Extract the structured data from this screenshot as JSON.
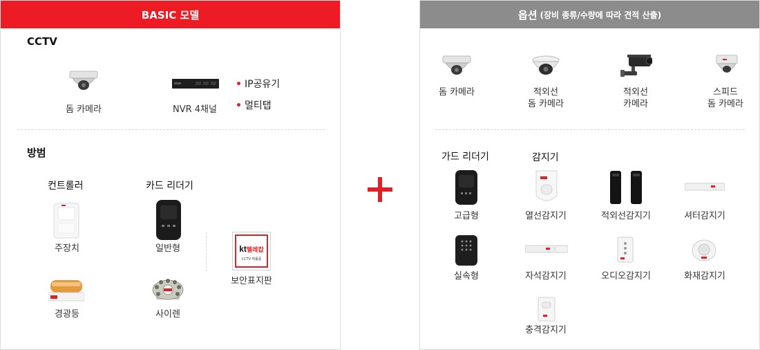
{
  "colors": {
    "basic_header": "#ed1c24",
    "option_header": "#8c8c8c",
    "plus": "#e31e24",
    "bullet": "#e31e24"
  },
  "basic": {
    "header": "BASIC 모델",
    "cctv": {
      "title": "CCTV",
      "dome_camera": "돔 카메라",
      "nvr": "NVR 4채널",
      "bullets": [
        "IP공유기",
        "멀티탭"
      ]
    },
    "security": {
      "title": "방범",
      "controller_title": "컨트롤러",
      "card_reader_title": "카드 리더기",
      "main_unit": "주장치",
      "card_reader": "일반형",
      "warning_light": "경광등",
      "siren": "사이렌",
      "sign": "보안표지판",
      "sign_brand": "kt",
      "sign_name": "텔레캅",
      "sign_sub": "CCTV 작동중"
    }
  },
  "plus_symbol": "+",
  "option": {
    "header": "옵션",
    "header_sub": "(장비 종류/수량에 따라 견적 산출)",
    "cameras": [
      {
        "line1": "돔 카메라",
        "line2": ""
      },
      {
        "line1": "적외선",
        "line2": "돔 카메라"
      },
      {
        "line1": "적외선",
        "line2": "카메라"
      },
      {
        "line1": "스피드",
        "line2": "돔 카메라"
      }
    ],
    "card_reader_title": "가드 리더기",
    "sensor_title": "감지기",
    "card_readers": [
      "고급형",
      "실속형"
    ],
    "sensors": [
      "열선감지기",
      "적외선감지기",
      "셔터감지기",
      "자석감지기",
      "오디오감지기",
      "화재감지기",
      "충격감지기"
    ]
  },
  "icons": {
    "dome_camera": "dome-camera-icon",
    "nvr": "nvr-recorder-icon",
    "ir_camera": "ir-bullet-camera-icon",
    "speed_dome": "speed-dome-icon",
    "card_reader": "card-reader-icon",
    "controller": "main-controller-icon",
    "warning_light": "warning-light-icon",
    "siren": "siren-icon",
    "sign": "security-sign-icon"
  }
}
